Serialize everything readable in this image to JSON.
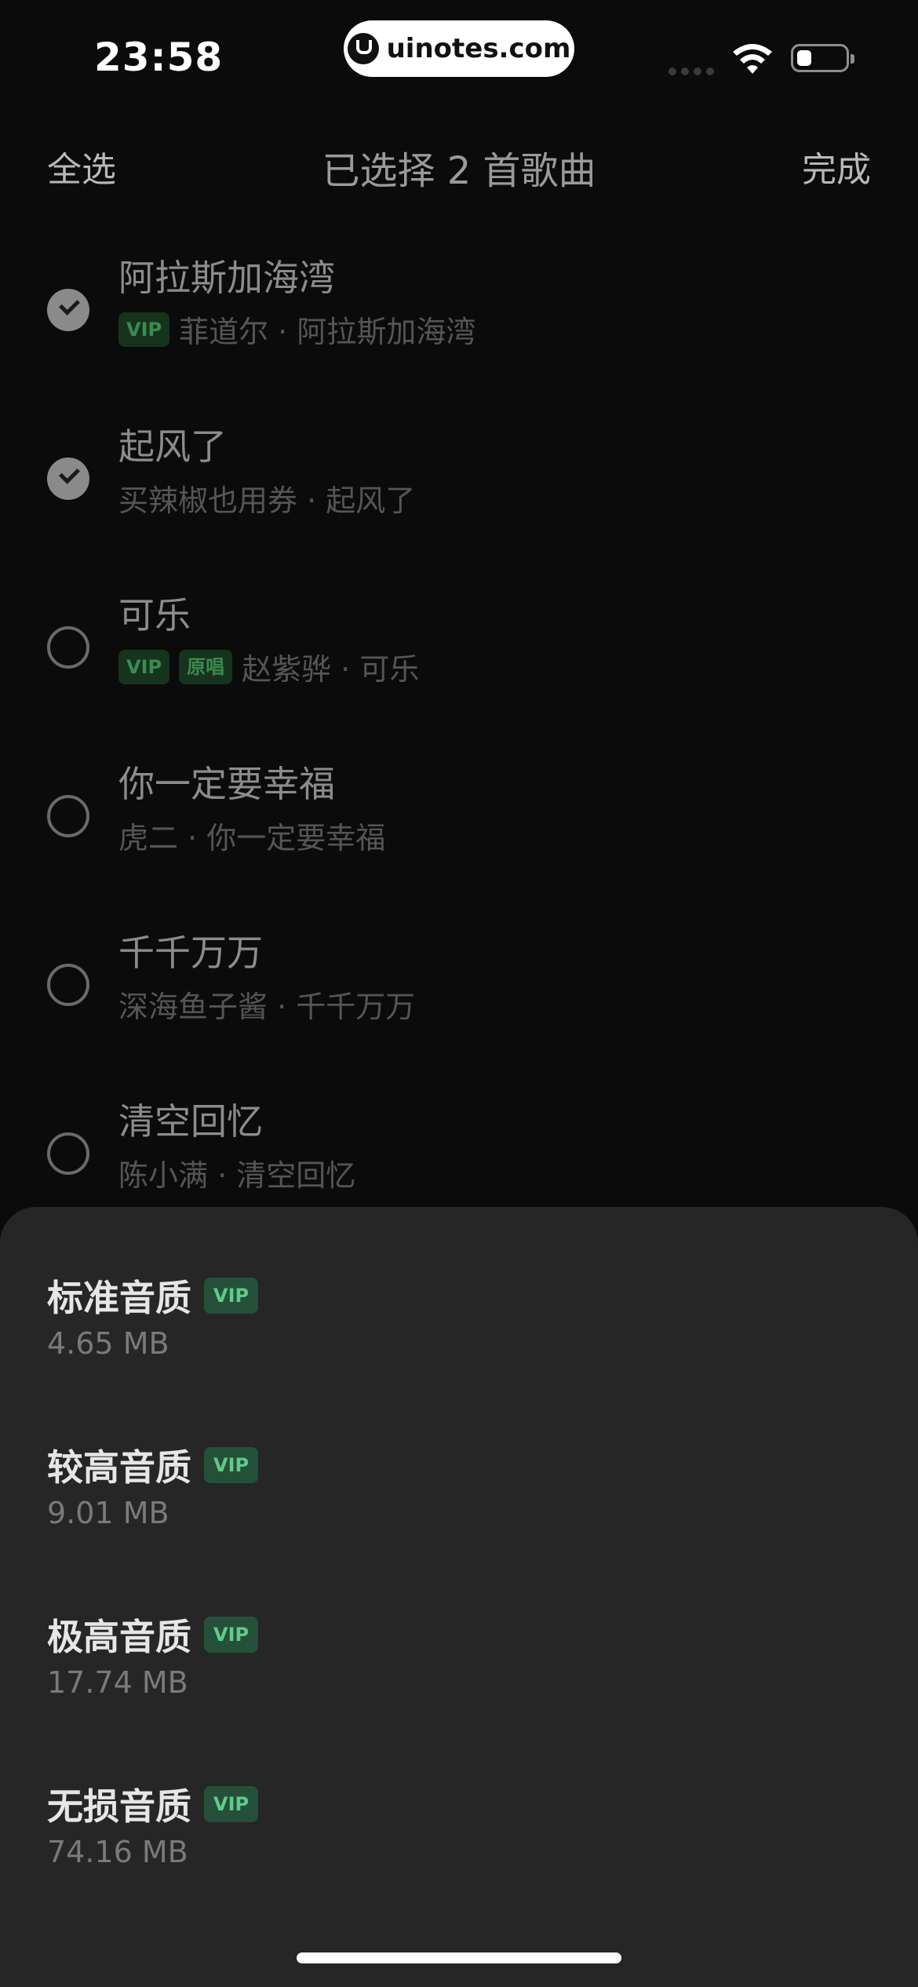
{
  "status_bar": {
    "time": "23:58",
    "watermark": "uinotes.com",
    "wifi_icon": "wifi-icon",
    "battery_icon": "battery-icon"
  },
  "header": {
    "select_all": "全选",
    "title": "已选择 2 首歌曲",
    "done": "完成"
  },
  "songs": [
    {
      "title": "阿拉斯加海湾",
      "tags": [
        "VIP"
      ],
      "subtitle": "菲道尔 · 阿拉斯加海湾",
      "checked": true
    },
    {
      "title": "起风了",
      "tags": [],
      "subtitle": "买辣椒也用券 · 起风了",
      "checked": true
    },
    {
      "title": "可乐",
      "tags": [
        "VIP",
        "原唱"
      ],
      "subtitle": "赵紫骅 · 可乐",
      "checked": false
    },
    {
      "title": "你一定要幸福",
      "tags": [],
      "subtitle": "虎二 · 你一定要幸福",
      "checked": false
    },
    {
      "title": "千千万万",
      "tags": [],
      "subtitle": "深海鱼子酱 · 千千万万",
      "checked": false
    },
    {
      "title": "清空回忆",
      "tags": [],
      "subtitle": "陈小满 · 清空回忆",
      "checked": false
    }
  ],
  "quality_sheet": {
    "options": [
      {
        "label": "标准音质",
        "badge": "VIP",
        "size": "4.65 MB"
      },
      {
        "label": "较高音质",
        "badge": "VIP",
        "size": "9.01 MB"
      },
      {
        "label": "极高音质",
        "badge": "VIP",
        "size": "17.74 MB"
      },
      {
        "label": "无损音质",
        "badge": "VIP",
        "size": "74.16 MB"
      }
    ]
  },
  "colors": {
    "background": "#0b0b0b",
    "sheet": "#262626",
    "vip_badge_bg": "#24503a",
    "vip_badge_text": "#62c98a"
  }
}
